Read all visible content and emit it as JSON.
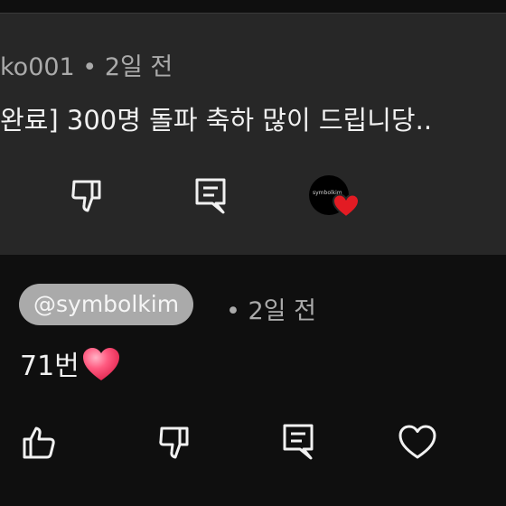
{
  "reply": {
    "author_meta": "ko001 • 2일 전",
    "text": "완료] 300명 돌파 축하 많이 드립니당..",
    "icons": [
      "dislike-icon",
      "reply-icon",
      "creator-heart-badge"
    ],
    "avatar_text": "symbolkim"
  },
  "comment": {
    "author": "@symbolkim",
    "meta": "• 2일 전",
    "text": "71번",
    "emoji": "heart",
    "icons": [
      "like-icon",
      "dislike-icon",
      "reply-icon",
      "heart-icon"
    ]
  },
  "colors": {
    "background": "#0f0f0f",
    "card": "#272727",
    "chip": "#aaaaaa",
    "heart": "#ff3b5c",
    "badge_heart": "#e31b23"
  }
}
